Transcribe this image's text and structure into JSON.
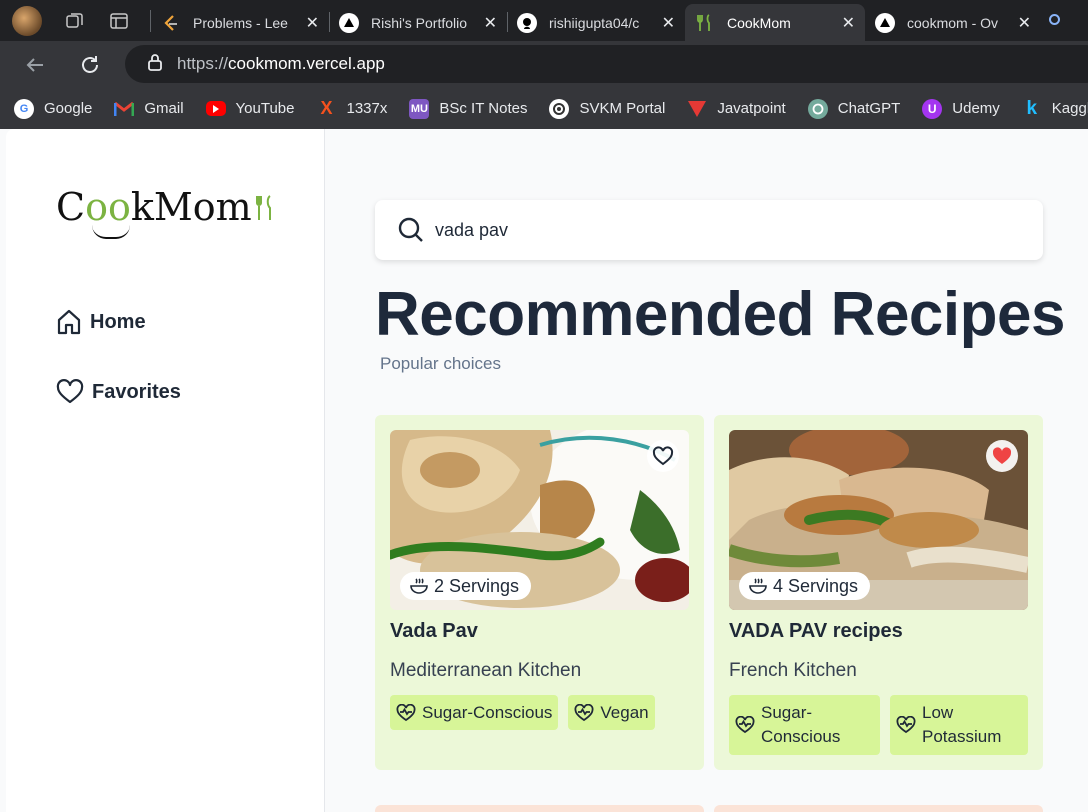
{
  "browser": {
    "tabs": [
      {
        "title": "Problems - Lee",
        "active": false
      },
      {
        "title": "Rishi's Portfolio",
        "active": false
      },
      {
        "title": "rishiigupta04/c",
        "active": false
      },
      {
        "title": "CookMom",
        "active": true
      },
      {
        "title": "cookmom - Ov",
        "active": false
      }
    ],
    "url_prefix": "https://",
    "url_host": "cookmom.vercel.app",
    "bookmarks": [
      {
        "label": "Google",
        "icon": "google-icon",
        "color": "#4285f4"
      },
      {
        "label": "Gmail",
        "icon": "gmail-icon",
        "color": "#ea4335"
      },
      {
        "label": "YouTube",
        "icon": "youtube-icon",
        "color": "#ff0000"
      },
      {
        "label": "1337x",
        "icon": "1337x-icon",
        "color": "#f4511e"
      },
      {
        "label": "BSc IT Notes",
        "icon": "mu-icon",
        "color": "#7e57c2"
      },
      {
        "label": "SVKM Portal",
        "icon": "svkm-icon",
        "color": "#ffffff"
      },
      {
        "label": "Javatpoint",
        "icon": "javatpoint-icon",
        "color": "#e53935"
      },
      {
        "label": "ChatGPT",
        "icon": "chatgpt-icon",
        "color": "#74aa9c"
      },
      {
        "label": "Udemy",
        "icon": "udemy-icon",
        "color": "#a435f0"
      },
      {
        "label": "Kaggle",
        "icon": "kaggle-icon",
        "color": "#20beff"
      }
    ]
  },
  "sidebar": {
    "logo": {
      "pre": "C",
      "oo": "oo",
      "post": "kMom"
    },
    "items": [
      {
        "label": "Home",
        "icon": "home-icon"
      },
      {
        "label": "Favorites",
        "icon": "heart-icon"
      }
    ]
  },
  "search": {
    "value": "vada pav"
  },
  "section": {
    "title": "Recommended Recipes",
    "subtitle": "Popular choices"
  },
  "recipes": [
    {
      "title": "Vada Pav",
      "kitchen": "Mediterranean Kitchen",
      "servings": "2 Servings",
      "favorited": false,
      "tags": [
        "Sugar-Conscious",
        "Vegan"
      ]
    },
    {
      "title": "VADA PAV recipes",
      "kitchen": "French Kitchen",
      "servings": "4 Servings",
      "favorited": true,
      "tags": [
        "Sugar-Conscious",
        "Low Potassium"
      ]
    }
  ],
  "colors": {
    "card_bg": "#ecf8d8",
    "tag_bg": "#d7f598",
    "heading": "#1e293b",
    "favorite_red": "#ef4444"
  }
}
